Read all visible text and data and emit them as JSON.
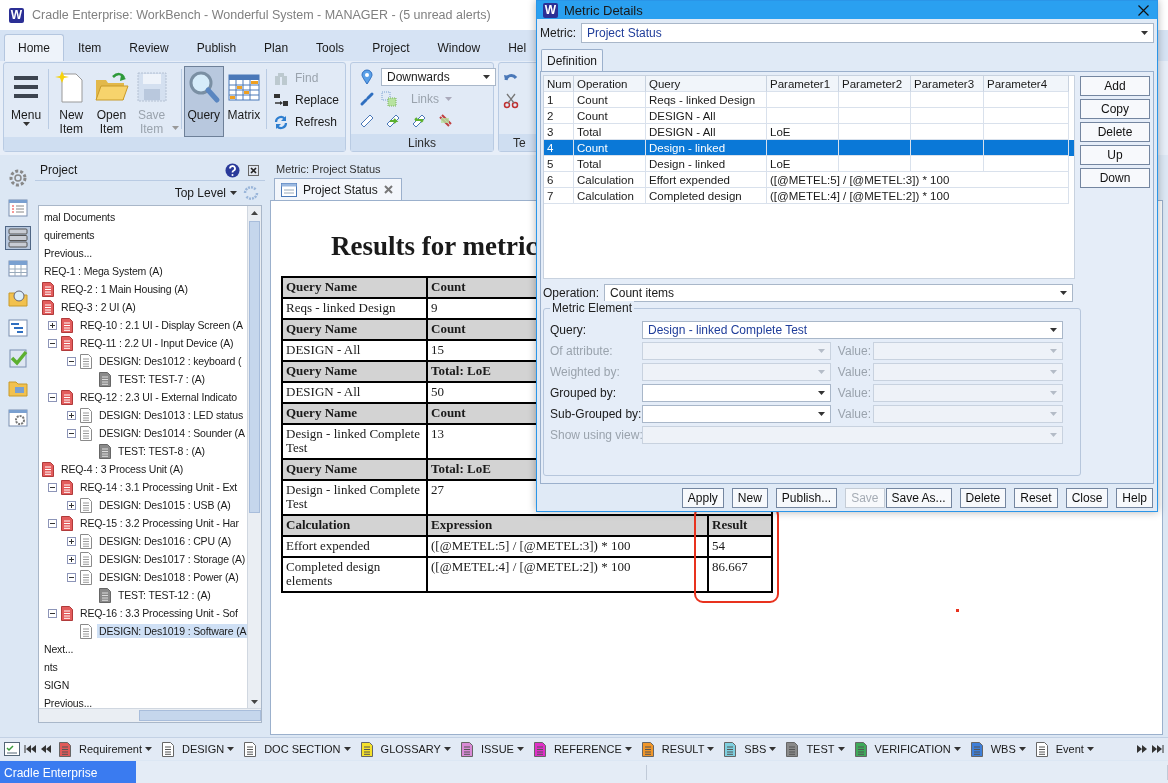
{
  "window": {
    "icon_text": "W",
    "title": "Cradle Enterprise: WorkBench - Wonderful System - MANAGER - (5 unread alerts)"
  },
  "ribbon": {
    "tabs": [
      {
        "label": "Home",
        "selected": true
      },
      {
        "label": "Item",
        "selected": false
      },
      {
        "label": "Review",
        "selected": false
      },
      {
        "label": "Publish",
        "selected": false
      },
      {
        "label": "Plan",
        "selected": false
      },
      {
        "label": "Tools",
        "selected": false
      },
      {
        "label": "Project",
        "selected": false
      },
      {
        "label": "Window",
        "selected": false
      },
      {
        "label": "Hel",
        "selected": false
      }
    ],
    "large_buttons": [
      {
        "label": "Menu",
        "disabled": false,
        "selected": false
      },
      {
        "label": "New Item",
        "disabled": false,
        "selected": false
      },
      {
        "label": "Open Item",
        "disabled": false,
        "selected": false
      },
      {
        "label": "Save Item",
        "disabled": true,
        "selected": false
      },
      {
        "label": "Query",
        "disabled": false,
        "selected": true
      },
      {
        "label": "Matrix",
        "disabled": false,
        "selected": false
      }
    ],
    "small_buttons": [
      {
        "label": "Find",
        "disabled": true
      },
      {
        "label": "Replace",
        "disabled": false
      },
      {
        "label": "Refresh",
        "disabled": false
      }
    ],
    "links_group": {
      "direction": "Downwards",
      "links_button": {
        "label": "Links",
        "disabled": true
      },
      "title": "Links"
    },
    "third_group": {
      "title": "Te"
    }
  },
  "left_rail": [
    {
      "selected": false
    },
    {
      "selected": false
    },
    {
      "selected": true
    },
    {
      "selected": false
    },
    {
      "selected": false
    },
    {
      "selected": false
    },
    {
      "selected": false
    },
    {
      "selected": false
    },
    {
      "selected": false
    }
  ],
  "project": {
    "title": "Project",
    "scope": "Top Level",
    "tree": [
      {
        "label": "mal Documents",
        "selected": false
      },
      {
        "label": "quirements",
        "selected": false
      },
      {
        "label": "Previous...",
        "selected": false
      },
      {
        "label": "REQ-1 : Mega System (A)",
        "selected": false,
        "children": [
          {
            "label": "REQ-2 : 1 Main Housing (A)",
            "kind": "req",
            "selected": false
          },
          {
            "label": "REQ-3 : 2 UI (A)",
            "kind": "req",
            "selected": false,
            "children": [
              {
                "label": "REQ-10 : 2.1 UI - Display Screen (A",
                "kind": "req",
                "expanded": false,
                "selected": false
              },
              {
                "label": "REQ-11 : 2.2 UI - Input Device (A)",
                "kind": "req",
                "expanded": true,
                "selected": false,
                "children": [
                  {
                    "label": "DESIGN: Des1012 : keyboard (",
                    "kind": "design",
                    "expanded": true,
                    "selected": false,
                    "children": [
                      {
                        "label": "TEST: TEST-7 :  (A)",
                        "kind": "test",
                        "selected": false
                      }
                    ]
                  }
                ]
              },
              {
                "label": "REQ-12 : 2.3 UI - External Indicato",
                "kind": "req",
                "expanded": true,
                "selected": false,
                "children": [
                  {
                    "label": "DESIGN: Des1013 : LED status",
                    "kind": "design",
                    "expanded": false,
                    "selected": false
                  },
                  {
                    "label": "DESIGN: Des1014 : Sounder (A",
                    "kind": "design",
                    "expanded": true,
                    "selected": false,
                    "children": [
                      {
                        "label": "TEST: TEST-8 :  (A)",
                        "kind": "test",
                        "selected": false
                      }
                    ]
                  }
                ]
              }
            ]
          },
          {
            "label": "REQ-4 : 3 Process Unit (A)",
            "kind": "req",
            "selected": false,
            "children": [
              {
                "label": "REQ-14 : 3.1 Processing Unit - Ext",
                "kind": "req",
                "expanded": true,
                "selected": false,
                "children": [
                  {
                    "label": "DESIGN: Des1015 : USB (A)",
                    "kind": "design",
                    "expanded": false,
                    "selected": false
                  }
                ]
              },
              {
                "label": "REQ-15 : 3.2 Processing Unit - Har",
                "kind": "req",
                "expanded": true,
                "selected": false,
                "children": [
                  {
                    "label": "DESIGN: Des1016 : CPU (A)",
                    "kind": "design",
                    "expanded": false,
                    "selected": false
                  },
                  {
                    "label": "DESIGN: Des1017 : Storage (A)",
                    "kind": "design",
                    "expanded": false,
                    "selected": false
                  },
                  {
                    "label": "DESIGN: Des1018 : Power (A)",
                    "kind": "design",
                    "expanded": true,
                    "selected": false,
                    "children": [
                      {
                        "label": "TEST: TEST-12 :  (A)",
                        "kind": "test",
                        "selected": false
                      }
                    ]
                  }
                ]
              },
              {
                "label": "REQ-16 : 3.3 Processing Unit - Sof",
                "kind": "req",
                "expanded": true,
                "selected": false,
                "children": [
                  {
                    "label": "DESIGN: Des1019 : Software (A",
                    "kind": "design",
                    "selected": true
                  }
                ]
              }
            ]
          }
        ]
      },
      {
        "label": "Next...",
        "selected": false
      },
      {
        "label": "nts",
        "selected": false
      },
      {
        "label": "SIGN",
        "selected": false
      },
      {
        "label": "Previous...",
        "selected": false
      }
    ]
  },
  "document": {
    "caption": "Metric: Project Status",
    "tabs": [
      {
        "label": "Project Status",
        "selected": true
      }
    ],
    "report": {
      "title": "Results for metric",
      "query_sections": [
        {
          "name_heading": "Query Name",
          "value_heading": "Count",
          "name": "Reqs - linked Design",
          "value": "9"
        },
        {
          "name_heading": "Query Name",
          "value_heading": "Count",
          "name": "DESIGN - All",
          "value": "15"
        },
        {
          "name_heading": "Query Name",
          "value_heading": "Total: LoE",
          "name": "DESIGN - All",
          "value": "50"
        },
        {
          "name_heading": "Query Name",
          "value_heading": "Count",
          "name": "Design - linked Complete Test",
          "value": "13"
        },
        {
          "name_heading": "Query Name",
          "value_heading": "Total: LoE",
          "name": "Design - linked Complete Test",
          "value": "27"
        }
      ],
      "calculation": {
        "columns": [
          "Calculation",
          "Expression",
          "Result"
        ],
        "rows": [
          {
            "name": "Effort expended",
            "expression": "([@METEL:5] / [@METEL:3]) * 100",
            "result": "54"
          },
          {
            "name": "Completed design elements",
            "expression": "([@METEL:4] / [@METEL:2]) * 100",
            "result": "86.667"
          }
        ]
      },
      "highlight": {
        "color": "#e8321e"
      }
    }
  },
  "item_types": [
    {
      "label": "Requirement",
      "color": "#e05a5a"
    },
    {
      "label": "DESIGN",
      "color": "#ffffff"
    },
    {
      "label": "DOC SECTION",
      "color": "#ffffff"
    },
    {
      "label": "GLOSSARY",
      "color": "#f5e12a"
    },
    {
      "label": "ISSUE",
      "color": "#d98ad6"
    },
    {
      "label": "REFERENCE",
      "color": "#e030c8"
    },
    {
      "label": "RESULT",
      "color": "#f0962a"
    },
    {
      "label": "SBS",
      "color": "#7fd0e0"
    },
    {
      "label": "TEST",
      "color": "#8a8a8a"
    },
    {
      "label": "VERIFICATION",
      "color": "#3faa5a"
    },
    {
      "label": "WBS",
      "color": "#3f7fd8"
    },
    {
      "label": "Event",
      "color": "#ffffff"
    }
  ],
  "status_bar": {
    "text": "Cradle Enterprise"
  },
  "dialog": {
    "icon_text": "W",
    "title": "Metric Details",
    "metric": {
      "label": "Metric:",
      "value": "Project Status"
    },
    "tabs": [
      {
        "label": "Definition",
        "selected": true
      }
    ],
    "grid": {
      "columns": [
        "Num",
        "Operation",
        "Query",
        "Parameter1",
        "Parameter2",
        "Parameter3",
        "Parameter4"
      ],
      "rows": [
        {
          "kind": "metric",
          "num": "1",
          "operation": "Count",
          "query": "Reqs - linked Design",
          "selected": false
        },
        {
          "kind": "metric",
          "num": "2",
          "operation": "Count",
          "query": "DESIGN - All",
          "selected": false
        },
        {
          "kind": "metric",
          "num": "3",
          "operation": "Total",
          "query": "DESIGN - All",
          "parameter1": "LoE",
          "selected": false
        },
        {
          "kind": "metric",
          "num": "4",
          "operation": "Count",
          "query": "Design - linked",
          "selected": true
        },
        {
          "kind": "metric",
          "num": "5",
          "operation": "Total",
          "query": "Design - linked",
          "parameter1": "LoE",
          "selected": false
        },
        {
          "kind": "calculation",
          "num": "6",
          "operation": "Calculation",
          "query": "Effort expended",
          "parameter1": "([@METEL:5] / [@METEL:3]) * 100",
          "selected": false
        },
        {
          "kind": "calculation",
          "num": "7",
          "operation": "Calculation",
          "query": "Completed design",
          "parameter1": "([@METEL:4] / [@METEL:2]) * 100",
          "selected": false
        }
      ]
    },
    "side_buttons": [
      "Add",
      "Copy",
      "Delete",
      "Up",
      "Down"
    ],
    "operation": {
      "label": "Operation:",
      "value": "Count items"
    },
    "metric_element": {
      "title": "Metric Element",
      "fields": [
        {
          "kind": "wide",
          "label": "Query:",
          "value": "Design - linked Complete Test",
          "disabled": false
        },
        {
          "kind": "paired",
          "label": "Of attribute:",
          "disabled": true,
          "value_field": {
            "label": "Value:",
            "disabled": true
          }
        },
        {
          "kind": "paired",
          "label": "Weighted by:",
          "disabled": true,
          "value_field": {
            "label": "Value:",
            "disabled": true
          }
        },
        {
          "kind": "paired",
          "label": "Grouped by:",
          "disabled": false,
          "value_field": {
            "label": "Value:",
            "disabled": true
          }
        },
        {
          "kind": "paired",
          "label": "Sub-Grouped by:",
          "disabled": false,
          "value_field": {
            "label": "Value:",
            "disabled": true
          }
        },
        {
          "kind": "wide",
          "label": "Show using view:",
          "disabled": true
        }
      ]
    },
    "buttons": [
      {
        "label": "Apply",
        "disabled": false
      },
      {
        "label": "New",
        "disabled": false
      },
      {
        "label": "Publish...",
        "disabled": false
      },
      {
        "label": "Save",
        "disabled": true
      },
      {
        "label": "Save As...",
        "disabled": false
      },
      {
        "label": "Delete",
        "disabled": false
      },
      {
        "label": "Reset",
        "disabled": false
      },
      {
        "label": "Close",
        "disabled": false
      },
      {
        "label": "Help",
        "disabled": false
      }
    ]
  }
}
